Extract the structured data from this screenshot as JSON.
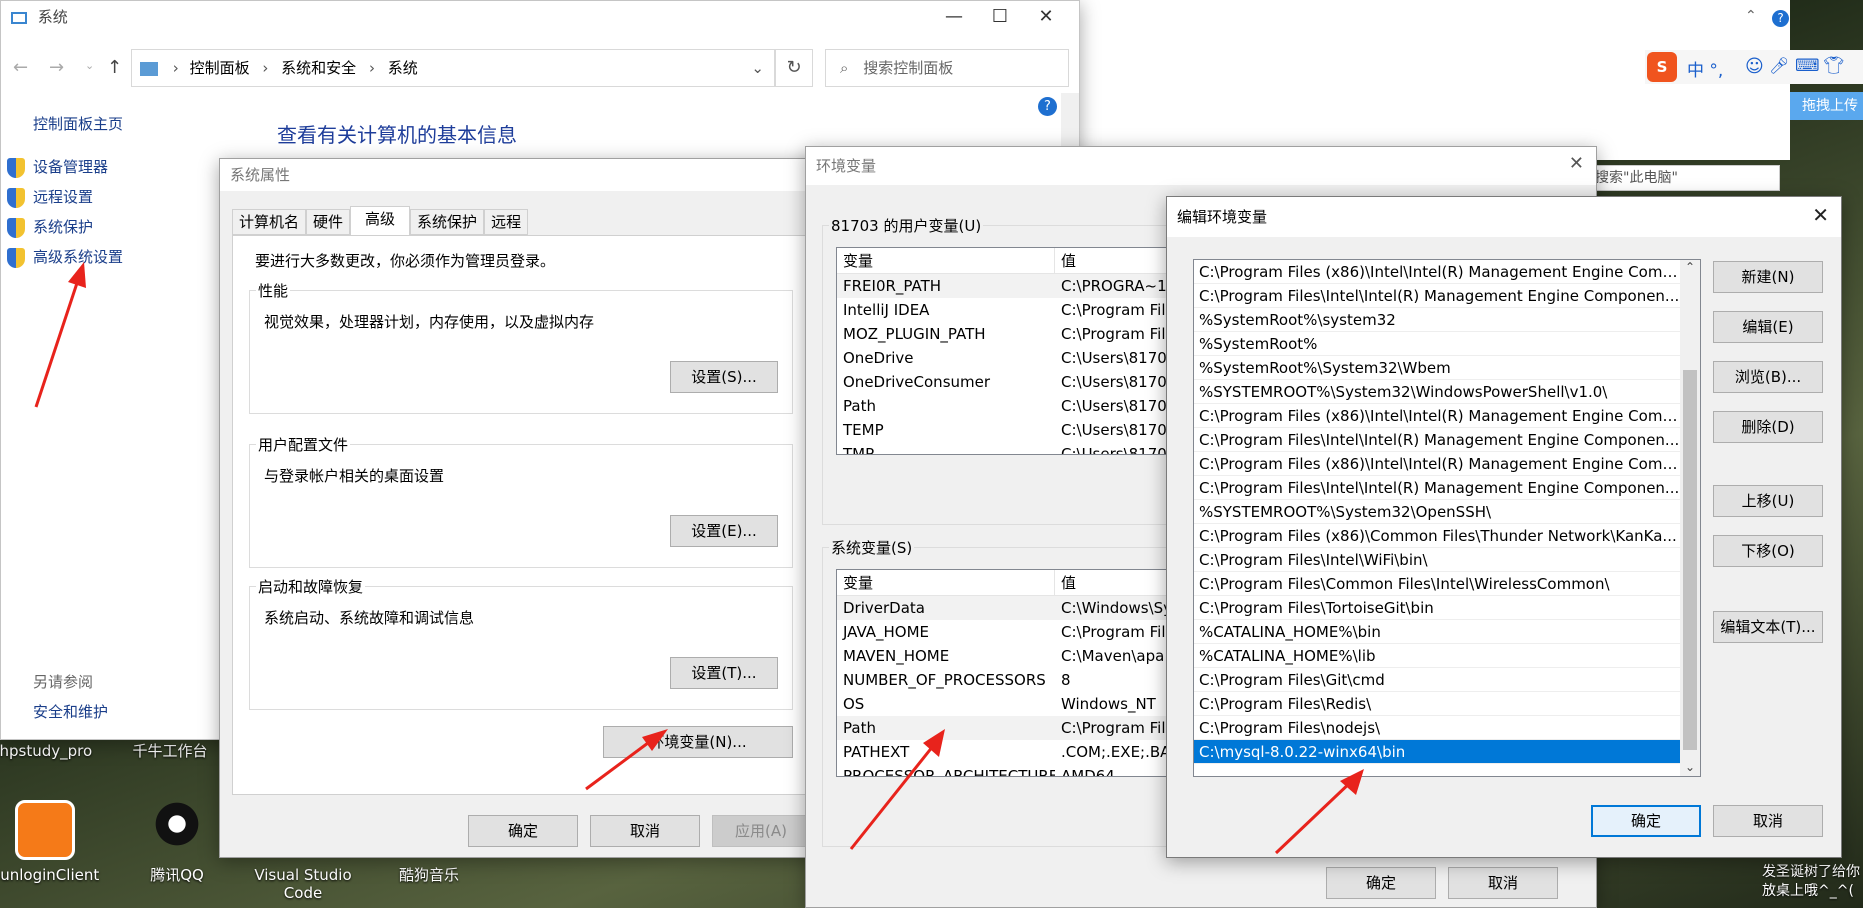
{
  "desktop": {
    "icons": [
      {
        "label": "phpstudy_pro"
      },
      {
        "label": "千牛工作台"
      },
      {
        "label": "SunloginClient"
      },
      {
        "label": "腾讯QQ"
      },
      {
        "label": "Visual Studio Code"
      },
      {
        "label": "酷狗音乐"
      }
    ],
    "corner_text_line1": "发圣诞树了给你",
    "corner_text_line2": "放桌上哦^_^(",
    "ime_label": "中 °,",
    "drag_upload": "拖拽上传"
  },
  "explorer_bg": {
    "search_placeholder": "搜索\"此电脑\""
  },
  "system_window": {
    "title": "系统",
    "breadcrumb": [
      "控制面板",
      "系统和安全",
      "系统"
    ],
    "search_placeholder": "搜索控制面板",
    "sidebar_home": "控制面板主页",
    "sidebar_items": [
      {
        "label": "设备管理器"
      },
      {
        "label": "远程设置"
      },
      {
        "label": "系统保护"
      },
      {
        "label": "高级系统设置"
      }
    ],
    "see_also": "另请参阅",
    "see_also_link": "安全和维护",
    "heading": "查看有关计算机的基本信息"
  },
  "sysprops": {
    "title": "系统属性",
    "tabs": [
      "计算机名",
      "硬件",
      "高级",
      "系统保护",
      "远程"
    ],
    "admin_note": "要进行大多数更改，你必须作为管理员登录。",
    "groups": [
      {
        "label": "性能",
        "desc": "视觉效果，处理器计划，内存使用，以及虚拟内存",
        "button": "设置(S)..."
      },
      {
        "label": "用户配置文件",
        "desc": "与登录帐户相关的桌面设置",
        "button": "设置(E)..."
      },
      {
        "label": "启动和故障恢复",
        "desc": "系统启动、系统故障和调试信息",
        "button": "设置(T)..."
      }
    ],
    "env_button": "环境变量(N)...",
    "ok": "确定",
    "cancel": "取消",
    "apply": "应用(A)"
  },
  "envvars": {
    "title": "环境变量",
    "user_group": "81703 的用户变量(U)",
    "system_group": "系统变量(S)",
    "col_var": "变量",
    "col_val": "值",
    "user_rows": [
      {
        "name": "FREI0R_PATH",
        "value": "C:\\PROGRA~1"
      },
      {
        "name": "IntelliJ IDEA",
        "value": "C:\\Program Fil"
      },
      {
        "name": "MOZ_PLUGIN_PATH",
        "value": "C:\\Program Fil"
      },
      {
        "name": "OneDrive",
        "value": "C:\\Users\\8170"
      },
      {
        "name": "OneDriveConsumer",
        "value": "C:\\Users\\8170"
      },
      {
        "name": "Path",
        "value": "C:\\Users\\8170"
      },
      {
        "name": "TEMP",
        "value": "C:\\Users\\8170"
      },
      {
        "name": "TMP",
        "value": "C:\\Users\\8170"
      }
    ],
    "system_rows": [
      {
        "name": "DriverData",
        "value": "C:\\Windows\\Sy"
      },
      {
        "name": "JAVA_HOME",
        "value": "C:\\Program Fil"
      },
      {
        "name": "MAVEN_HOME",
        "value": "C:\\Maven\\apa"
      },
      {
        "name": "NUMBER_OF_PROCESSORS",
        "value": "8"
      },
      {
        "name": "OS",
        "value": "Windows_NT"
      },
      {
        "name": "Path",
        "value": "C:\\Program Fil"
      },
      {
        "name": "PATHEXT",
        "value": ".COM;.EXE;.BA"
      },
      {
        "name": "PROCESSOR_ARCHITECTURE",
        "value": "AMD64"
      }
    ],
    "ok": "确定",
    "cancel": "取消"
  },
  "editenv": {
    "title": "编辑环境变量",
    "paths": [
      "C:\\Program Files (x86)\\Intel\\Intel(R) Management Engine Comp...",
      "C:\\Program Files\\Intel\\Intel(R) Management Engine Componen...",
      "%SystemRoot%\\system32",
      "%SystemRoot%",
      "%SystemRoot%\\System32\\Wbem",
      "%SYSTEMROOT%\\System32\\WindowsPowerShell\\v1.0\\",
      "C:\\Program Files (x86)\\Intel\\Intel(R) Management Engine Comp...",
      "C:\\Program Files\\Intel\\Intel(R) Management Engine Componen...",
      "C:\\Program Files (x86)\\Intel\\Intel(R) Management Engine Comp...",
      "C:\\Program Files\\Intel\\Intel(R) Management Engine Componen...",
      "%SYSTEMROOT%\\System32\\OpenSSH\\",
      "C:\\Program Files (x86)\\Common Files\\Thunder Network\\KanKa...",
      "C:\\Program Files\\Intel\\WiFi\\bin\\",
      "C:\\Program Files\\Common Files\\Intel\\WirelessCommon\\",
      "C:\\Program Files\\TortoiseGit\\bin",
      "%CATALINA_HOME%\\bin",
      "%CATALINA_HOME%\\lib",
      "C:\\Program Files\\Git\\cmd",
      "C:\\Program Files\\Redis\\",
      "C:\\Program Files\\nodejs\\",
      "C:\\mysql-8.0.22-winx64\\bin"
    ],
    "selected_index": 20,
    "buttons": [
      "新建(N)",
      "编辑(E)",
      "浏览(B)...",
      "删除(D)",
      "上移(U)",
      "下移(O)",
      "编辑文本(T)..."
    ],
    "ok": "确定",
    "cancel": "取消"
  }
}
